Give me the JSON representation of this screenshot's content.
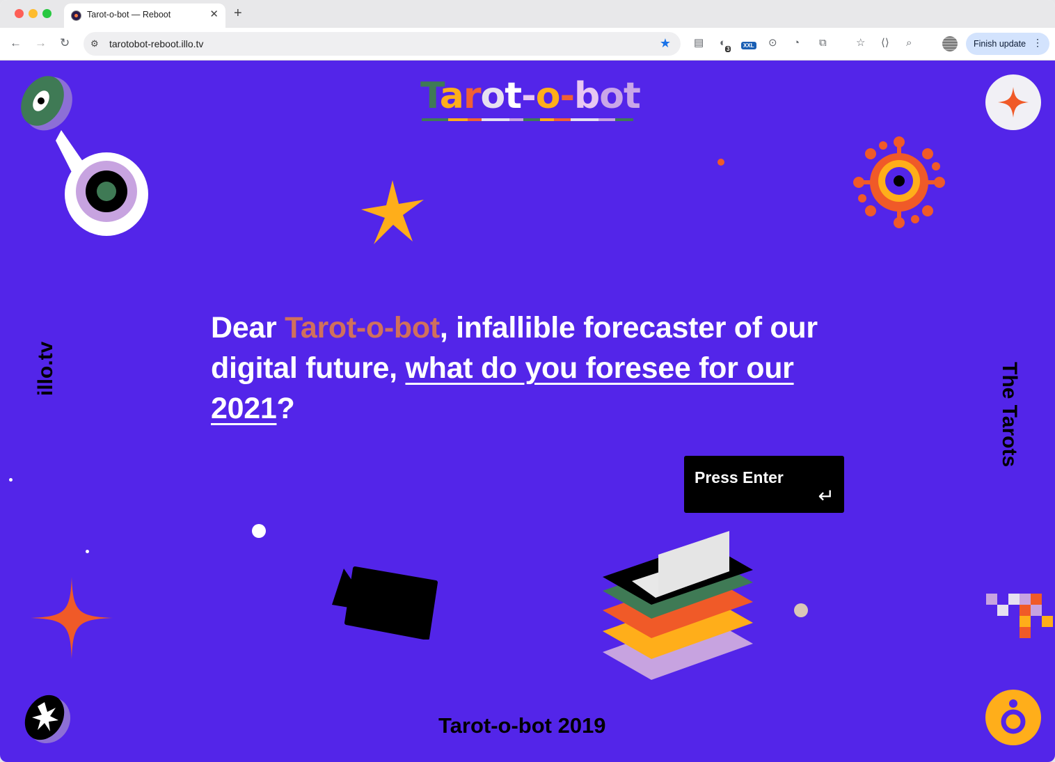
{
  "browser": {
    "tab_title": "Tarot-o-bot — Reboot",
    "tab_close": "✕",
    "new_tab": "+",
    "url": "tarotobot-reboot.illo.tv",
    "update_label": "Finish update",
    "ext_badge_count": "3",
    "ext_xxl_label": "XXL"
  },
  "page": {
    "logo": {
      "text": "Tarot-o-bot",
      "letter_colors": [
        "#3f7a55",
        "#ffae1a",
        "#f06035",
        "#e6e0f0",
        "#ffffff",
        "#e8c7f2",
        "#ffae1a",
        "#f06035",
        "#e8c7f2",
        "#c9a6e8",
        "#c9a6e8"
      ]
    },
    "headline": {
      "prefix": "Dear ",
      "accent": "Tarot-o-bot",
      "middle": ", infallible forecaster of our digital future, ",
      "link": "what do you foresee for our 2021",
      "suffix": "?"
    },
    "press_enter": "Press Enter",
    "press_enter_icon": "↵",
    "side_left": "illo.tv",
    "side_right": "The Tarots",
    "footer": "Tarot-o-bot 2019",
    "colors": {
      "background": "#5325e9",
      "accent": "#d0705c",
      "orange": "#f05a28",
      "yellow": "#ffae1a",
      "green": "#3f7a55",
      "lilac": "#c7a3e0"
    }
  }
}
